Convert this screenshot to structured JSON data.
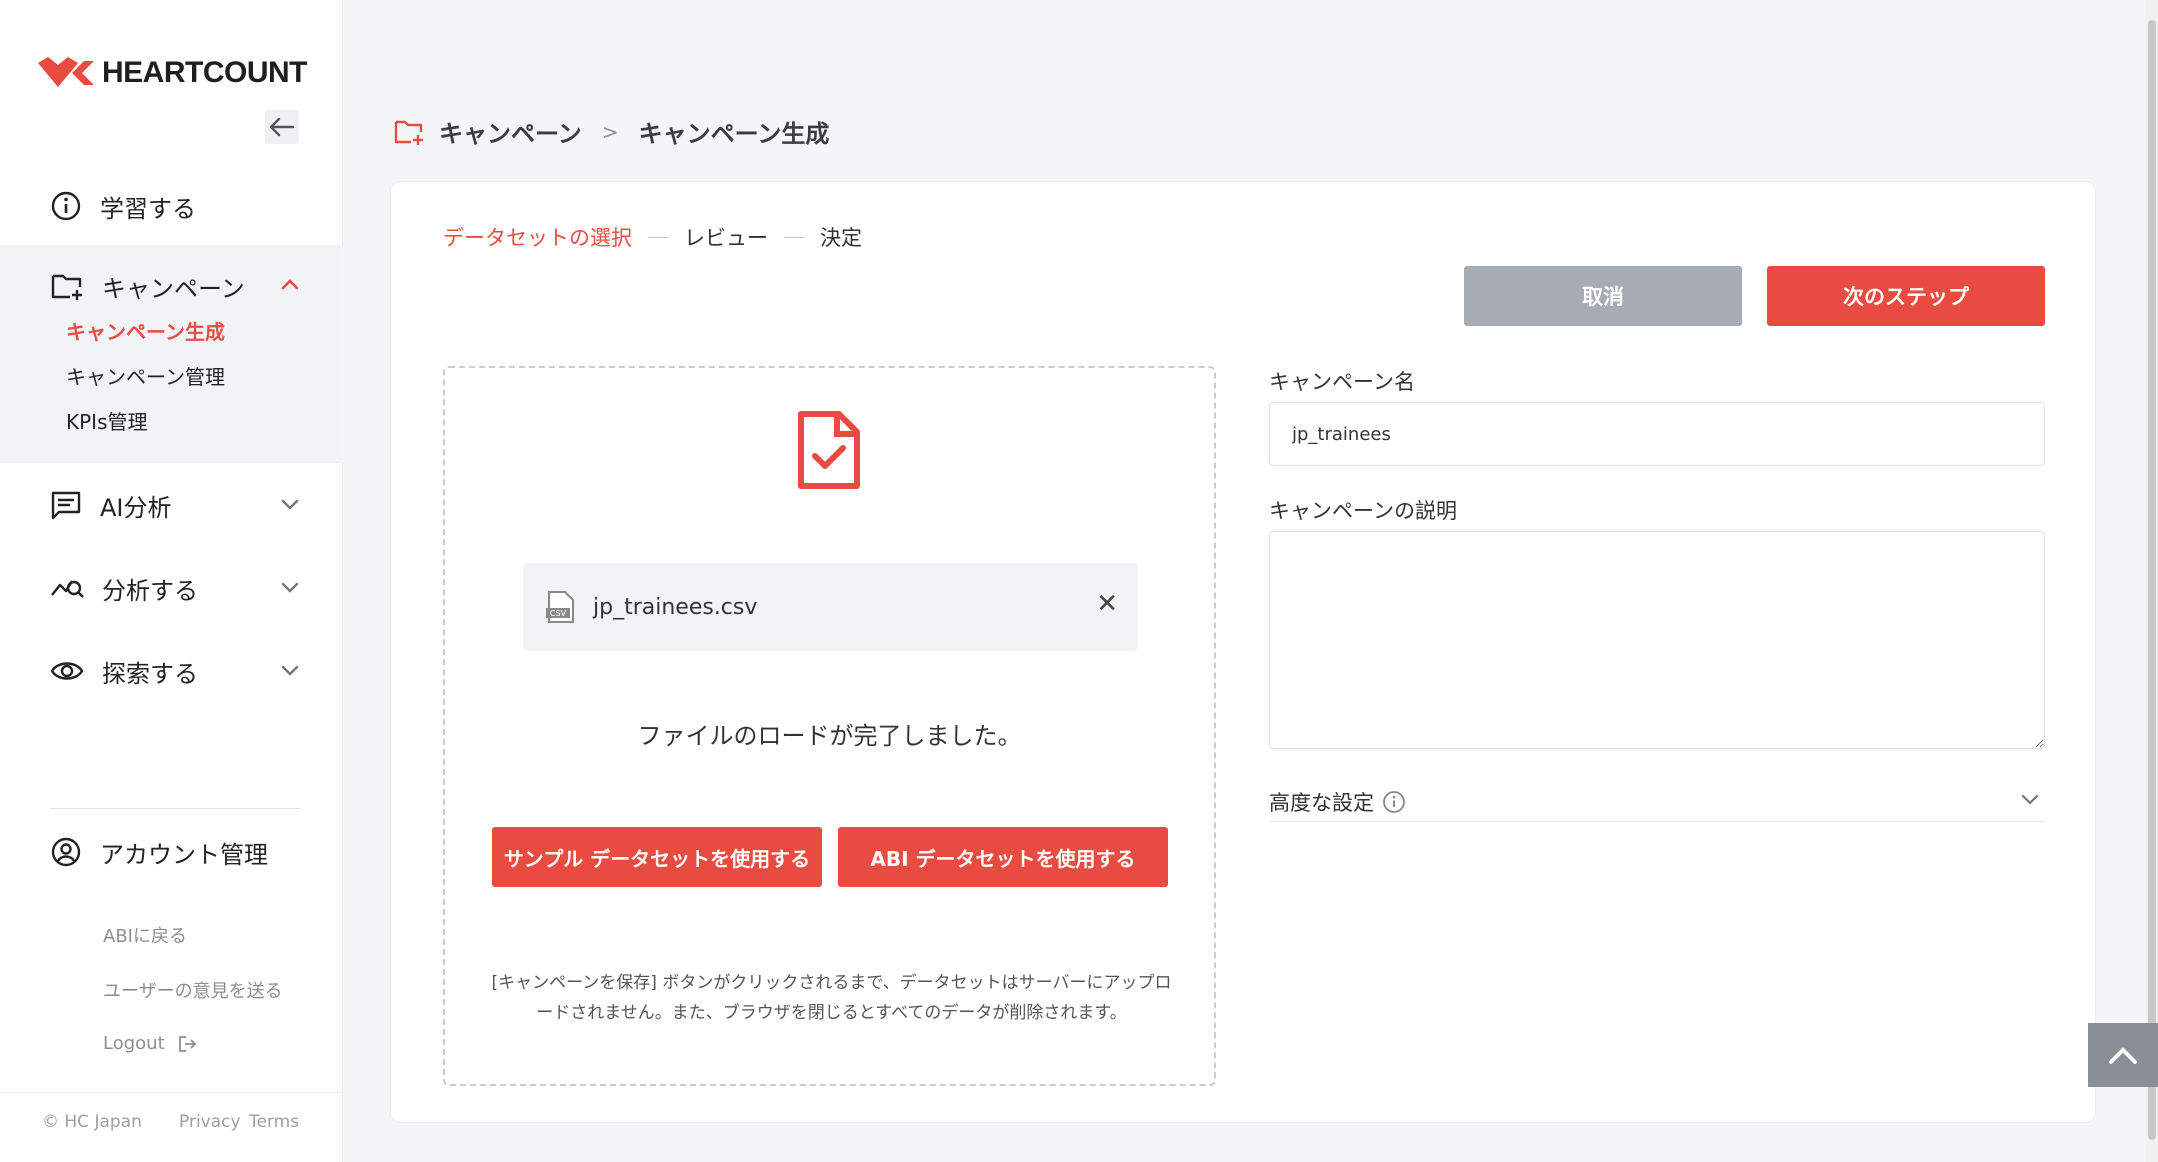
{
  "brand": {
    "name": "HEARTCOUNT",
    "accent": "#e84c40"
  },
  "sidebar": {
    "items": [
      {
        "label": "学習する",
        "icon": "info-icon"
      },
      {
        "label": "キャンペーン",
        "icon": "folder-plus-icon"
      },
      {
        "label": "AI分析",
        "icon": "chat-icon"
      },
      {
        "label": "分析する",
        "icon": "analytics-icon"
      },
      {
        "label": "探索する",
        "icon": "eye-icon"
      }
    ],
    "campaign_sub": [
      "キャンペーン生成",
      "キャンペーン管理",
      "KPIs管理"
    ],
    "account": "アカウント管理",
    "links": [
      "ABIに戻る",
      "ユーザーの意見を送る",
      "Logout"
    ],
    "footer": {
      "copyright": "© HC Japan",
      "privacy": "Privacy",
      "terms": "Terms"
    }
  },
  "breadcrumb": {
    "parent": "キャンペーン",
    "separator": ">",
    "current": "キャンペーン生成"
  },
  "steps": [
    "データセットの選択",
    "レビュー",
    "決定"
  ],
  "actions": {
    "cancel": "取消",
    "next": "次のステップ"
  },
  "upload": {
    "file_name": "jp_trainees.csv",
    "done_message": "ファイルのロードが完了しました。",
    "sample_button": "サンプル データセットを使用する",
    "abi_button": "ABI データセットを使用する",
    "notice": "[キャンペーンを保存] ボタンがクリックされるまで、データセットはサーバーにアップロードされません。また、ブラウザを閉じるとすべてのデータが削除されます。"
  },
  "form": {
    "name_label": "キャンペーン名",
    "name_value": "jp_trainees",
    "desc_label": "キャンペーンの説明",
    "desc_value": "",
    "advanced_label": "高度な設定"
  }
}
